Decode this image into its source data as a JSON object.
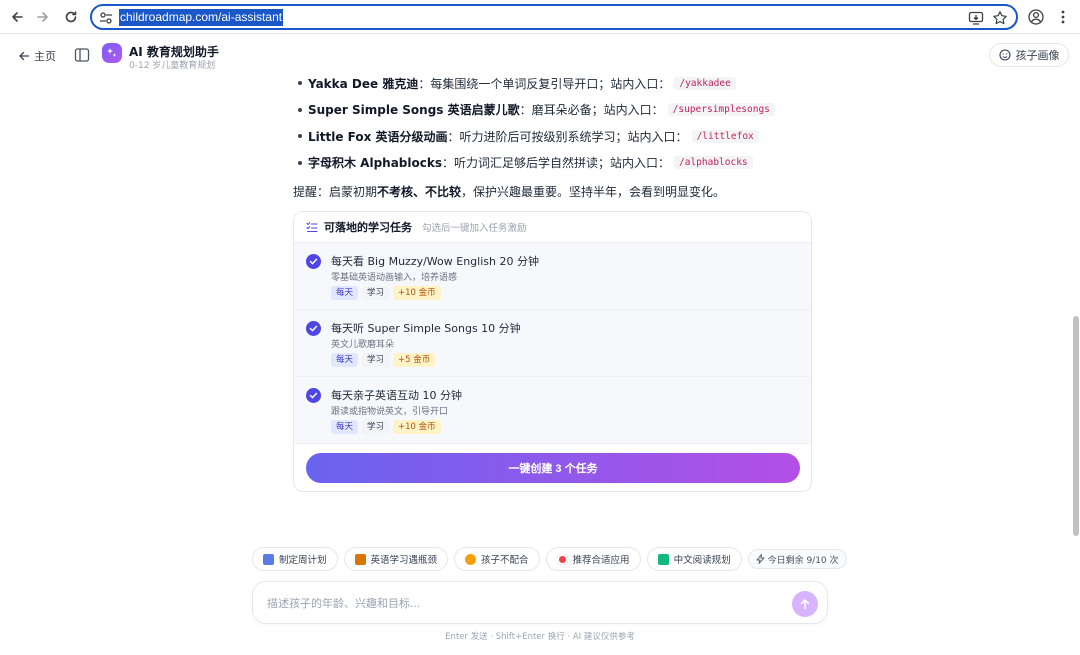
{
  "browser": {
    "url": "childroadmap.com/ai-assistant"
  },
  "header": {
    "home_label": "主页",
    "app_title": "AI 教育规划助手",
    "app_subtitle": "0-12 岁儿童教育规划",
    "profile_label": "孩子画像"
  },
  "resources": [
    {
      "name": "Yakka Dee 雅克迪",
      "desc": "：每集围绕一个单词反复引导开口；站内入口：",
      "code": "/yakkadee"
    },
    {
      "name": "Super Simple Songs 英语启蒙儿歌",
      "desc": "：磨耳朵必备；站内入口：",
      "code": "/supersimplesongs"
    },
    {
      "name": "Little Fox 英语分级动画",
      "desc": "：听力进阶后可按级别系统学习；站内入口：",
      "code": "/littlefox"
    },
    {
      "name": "字母积木 Alphablocks",
      "desc": "：听力词汇足够后学自然拼读；站内入口：",
      "code": "/alphablocks"
    }
  ],
  "reminder": {
    "prefix": "提醒：启蒙初期",
    "bold": "不考核、不比较",
    "suffix": "，保护兴趣最重要。坚持半年，会看到明显变化。"
  },
  "task_card": {
    "title": "可落地的学习任务",
    "hint": "勾选后一键加入任务激励",
    "tasks": [
      {
        "title": "每天看 Big Muzzy/Wow English 20 分钟",
        "desc": "零基础英语动画输入，培养语感",
        "freq": "每天",
        "category": "学习",
        "reward": "+10 金币"
      },
      {
        "title": "每天听 Super Simple Songs 10 分钟",
        "desc": "英文儿歌磨耳朵",
        "freq": "每天",
        "category": "学习",
        "reward": "+5 金币"
      },
      {
        "title": "每天亲子英语互动 10 分钟",
        "desc": "跟读或指物说英文，引导开口",
        "freq": "每天",
        "category": "学习",
        "reward": "+10 金币"
      }
    ],
    "create_label": "一键创建 3 个任务"
  },
  "quick_prompts": [
    {
      "label": "制定周计划",
      "icon": "calendar-icon",
      "color": "#5b7be8"
    },
    {
      "label": "英语学习遇瓶颈",
      "icon": "books-icon",
      "color": "#d97706"
    },
    {
      "label": "孩子不配合",
      "icon": "child-icon",
      "color": "#f59e0b"
    },
    {
      "label": "推荐合适应用",
      "icon": "target-icon",
      "color": "#ef4444"
    },
    {
      "label": "中文阅读规划",
      "icon": "reading-icon",
      "color": "#10b981"
    }
  ],
  "quota_label": "今日剩余 9/10 次",
  "composer": {
    "placeholder": "描述孩子的年龄、兴趣和目标..."
  },
  "footer_hint": "Enter 发送 · Shift+Enter 换行 · AI 建议仅供参考"
}
